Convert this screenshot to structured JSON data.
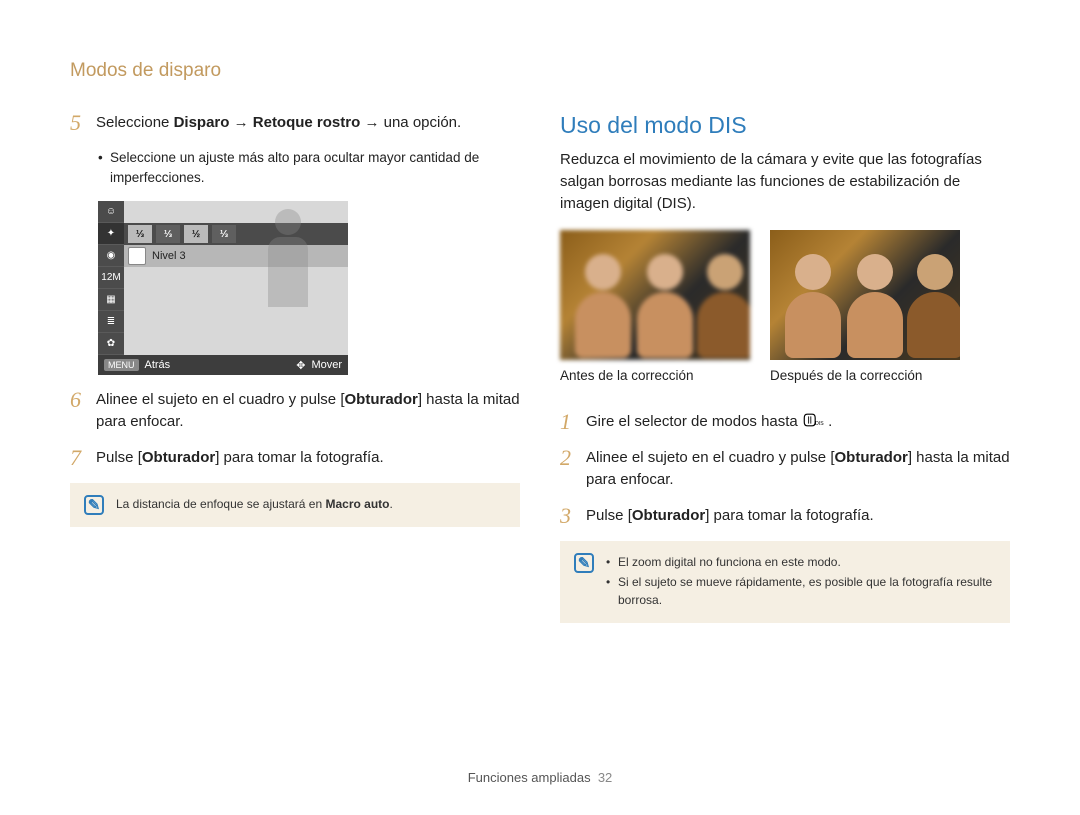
{
  "header": "Modos de disparo",
  "left": {
    "step5": {
      "num": "5",
      "prefix": "Seleccione ",
      "bold1": "Disparo",
      "arrow1": " → ",
      "bold2": "Retoque rostro",
      "arrow2": " → ",
      "suffix": "una opción."
    },
    "step5_bullet": "Seleccione un ajuste más alto para ocultar mayor cantidad de imperfecciones.",
    "screen": {
      "fraction1": "⅓",
      "fraction1_white": "⅓",
      "fraction2": "½",
      "fraction2_white": "⅓",
      "level_label": "Nivel 3",
      "menu_tag": "MENU",
      "back": "Atrás",
      "move": "Mover",
      "side_12m": "12M"
    },
    "step6": {
      "num": "6",
      "before": "Alinee el sujeto en el cuadro y pulse [",
      "bold": "Obturador",
      "after": "] hasta la mitad para enfocar."
    },
    "step7": {
      "num": "7",
      "before": "Pulse [",
      "bold": "Obturador",
      "after": "] para tomar la fotografía."
    },
    "note": {
      "before": "La distancia de enfoque se ajustará en ",
      "bold": "Macro auto",
      "after": "."
    }
  },
  "right": {
    "title": "Uso del modo DIS",
    "intro": "Reduzca el movimiento de la cámara y evite que las fotografías salgan borrosas mediante las funciones de estabilización de imagen digital (DIS).",
    "caption_before": "Antes de la corrección",
    "caption_after": "Después de la corrección",
    "step1": {
      "num": "1",
      "text_before": "Gire el selector de modos hasta ",
      "text_after": "."
    },
    "step2": {
      "num": "2",
      "before": "Alinee el sujeto en el cuadro y pulse [",
      "bold": "Obturador",
      "after": "] hasta la mitad para enfocar."
    },
    "step3": {
      "num": "3",
      "before": "Pulse [",
      "bold": "Obturador",
      "after": "] para tomar la fotografía."
    },
    "note_items": [
      "El zoom digital no funciona en este modo.",
      "Si el sujeto se mueve rápidamente, es posible que la fotografía resulte borrosa."
    ]
  },
  "footer": {
    "label": "Funciones ampliadas",
    "page": "32"
  }
}
